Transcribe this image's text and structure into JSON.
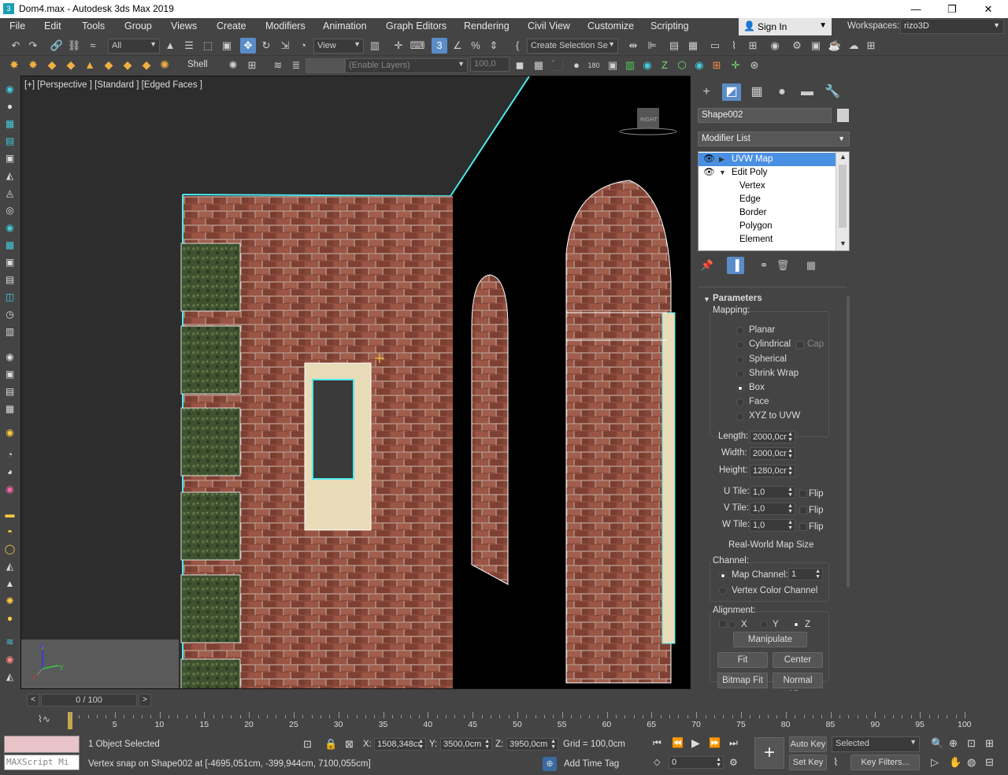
{
  "window": {
    "title": "Dom4.max - Autodesk 3ds Max 2019",
    "app_icon": "3ds-max-icon",
    "min_icon": "minimize-icon",
    "max_icon": "maximize-icon",
    "close_icon": "close-icon",
    "min_glyph": "—",
    "max_glyph": "❐",
    "close_glyph": "✕"
  },
  "menubar": {
    "items": [
      "File",
      "Edit",
      "Tools",
      "Group",
      "Views",
      "Create",
      "Modifiers",
      "Animation",
      "Graph Editors",
      "Rendering",
      "Civil View",
      "Customize",
      "Scripting"
    ],
    "signin": "Sign In",
    "workspaces_label": "Workspaces:",
    "workspace_value": "rizo3D"
  },
  "toolbar": {
    "selection_filter": "All",
    "ref_coord": "View",
    "named_selection": "Create Selection Se",
    "snap_toggle": "3",
    "layer_label": "Shell",
    "layer_field": "(Enable Layers)",
    "layer_value": "100,0"
  },
  "viewport": {
    "label": "[+] [Perspective ] [Standard ] [Edged Faces ]",
    "viewcube_label": "RIGHT",
    "axis_x": "x",
    "axis_y": "y",
    "axis_z": "z"
  },
  "command_panel": {
    "tabs": [
      "create-tab",
      "modify-tab",
      "hierarchy-tab",
      "motion-tab",
      "display-tab",
      "utilities-tab"
    ],
    "tab_glyphs": [
      "+",
      "◩",
      "▦",
      "●",
      "▬",
      "🔧"
    ],
    "object_name": "Shape002",
    "modifier_list": "Modifier List",
    "stack": [
      {
        "label": "UVW Map",
        "level": 0,
        "selected": true
      },
      {
        "label": "Edit Poly",
        "level": 0,
        "selected": false
      },
      {
        "label": "Vertex",
        "level": 1,
        "selected": false
      },
      {
        "label": "Edge",
        "level": 1,
        "selected": false
      },
      {
        "label": "Border",
        "level": 1,
        "selected": false
      },
      {
        "label": "Polygon",
        "level": 1,
        "selected": false
      },
      {
        "label": "Element",
        "level": 1,
        "selected": false
      }
    ],
    "rollout_title": "Parameters",
    "mapping_label": "Mapping:",
    "mapping_options": [
      "Planar",
      "Cylindrical",
      "Spherical",
      "Shrink Wrap",
      "Box",
      "Face",
      "XYZ to UVW"
    ],
    "mapping_selected": "Box",
    "cap_label": "Cap",
    "length_label": "Length:",
    "length_value": "2000,0cr",
    "width_label": "Width:",
    "width_value": "2000,0cr",
    "height_label": "Height:",
    "height_value": "1280,0cr",
    "utile_label": "U Tile:",
    "utile_value": "1,0",
    "vtile_label": "V Tile:",
    "vtile_value": "1,0",
    "wtile_label": "W Tile:",
    "wtile_value": "1,0",
    "flip_label": "Flip",
    "realworld_label": "Real-World Map Size",
    "channel_label": "Channel:",
    "map_channel_label": "Map Channel:",
    "map_channel_value": "1",
    "vertex_color_label": "Vertex Color Channel",
    "alignment_label": "Alignment:",
    "align_x": "X",
    "align_y": "Y",
    "align_z": "Z",
    "align_selected": "Z",
    "manipulate": "Manipulate",
    "fit": "Fit",
    "center": "Center",
    "bitmap_fit": "Bitmap Fit",
    "normal_align": "Normal Align"
  },
  "timeline": {
    "slider": "0 / 100",
    "ticks": [
      "5",
      "10",
      "15",
      "20",
      "25",
      "30",
      "35",
      "40",
      "45",
      "50",
      "55",
      "60",
      "65",
      "70",
      "75",
      "80",
      "85",
      "90",
      "95",
      "100"
    ]
  },
  "status": {
    "maxscript": "MAXScript Mi",
    "selected": "1 Object Selected",
    "prompt": "Vertex snap on Shape002 at [-4695,051cm, -399,944cm, 7100,055cm]",
    "x_label": "X:",
    "x_value": "1508,348cı",
    "y_label": "Y:",
    "y_value": "3500,0cm",
    "z_label": "Z:",
    "z_value": "3950,0cm",
    "grid": "Grid = 100,0cm",
    "add_time_tag": "Add Time Tag",
    "auto_key": "Auto Key",
    "set_key": "Set Key",
    "key_mode": "Selected",
    "key_filters": "Key Filters...",
    "frame": "0"
  },
  "colors": {
    "ui_bg": "#444444",
    "accent": "#5a8cc7",
    "brick": "#8a4a3c",
    "selection_cyan": "#4ee8f0",
    "window_frame": "#e8dcb8"
  }
}
